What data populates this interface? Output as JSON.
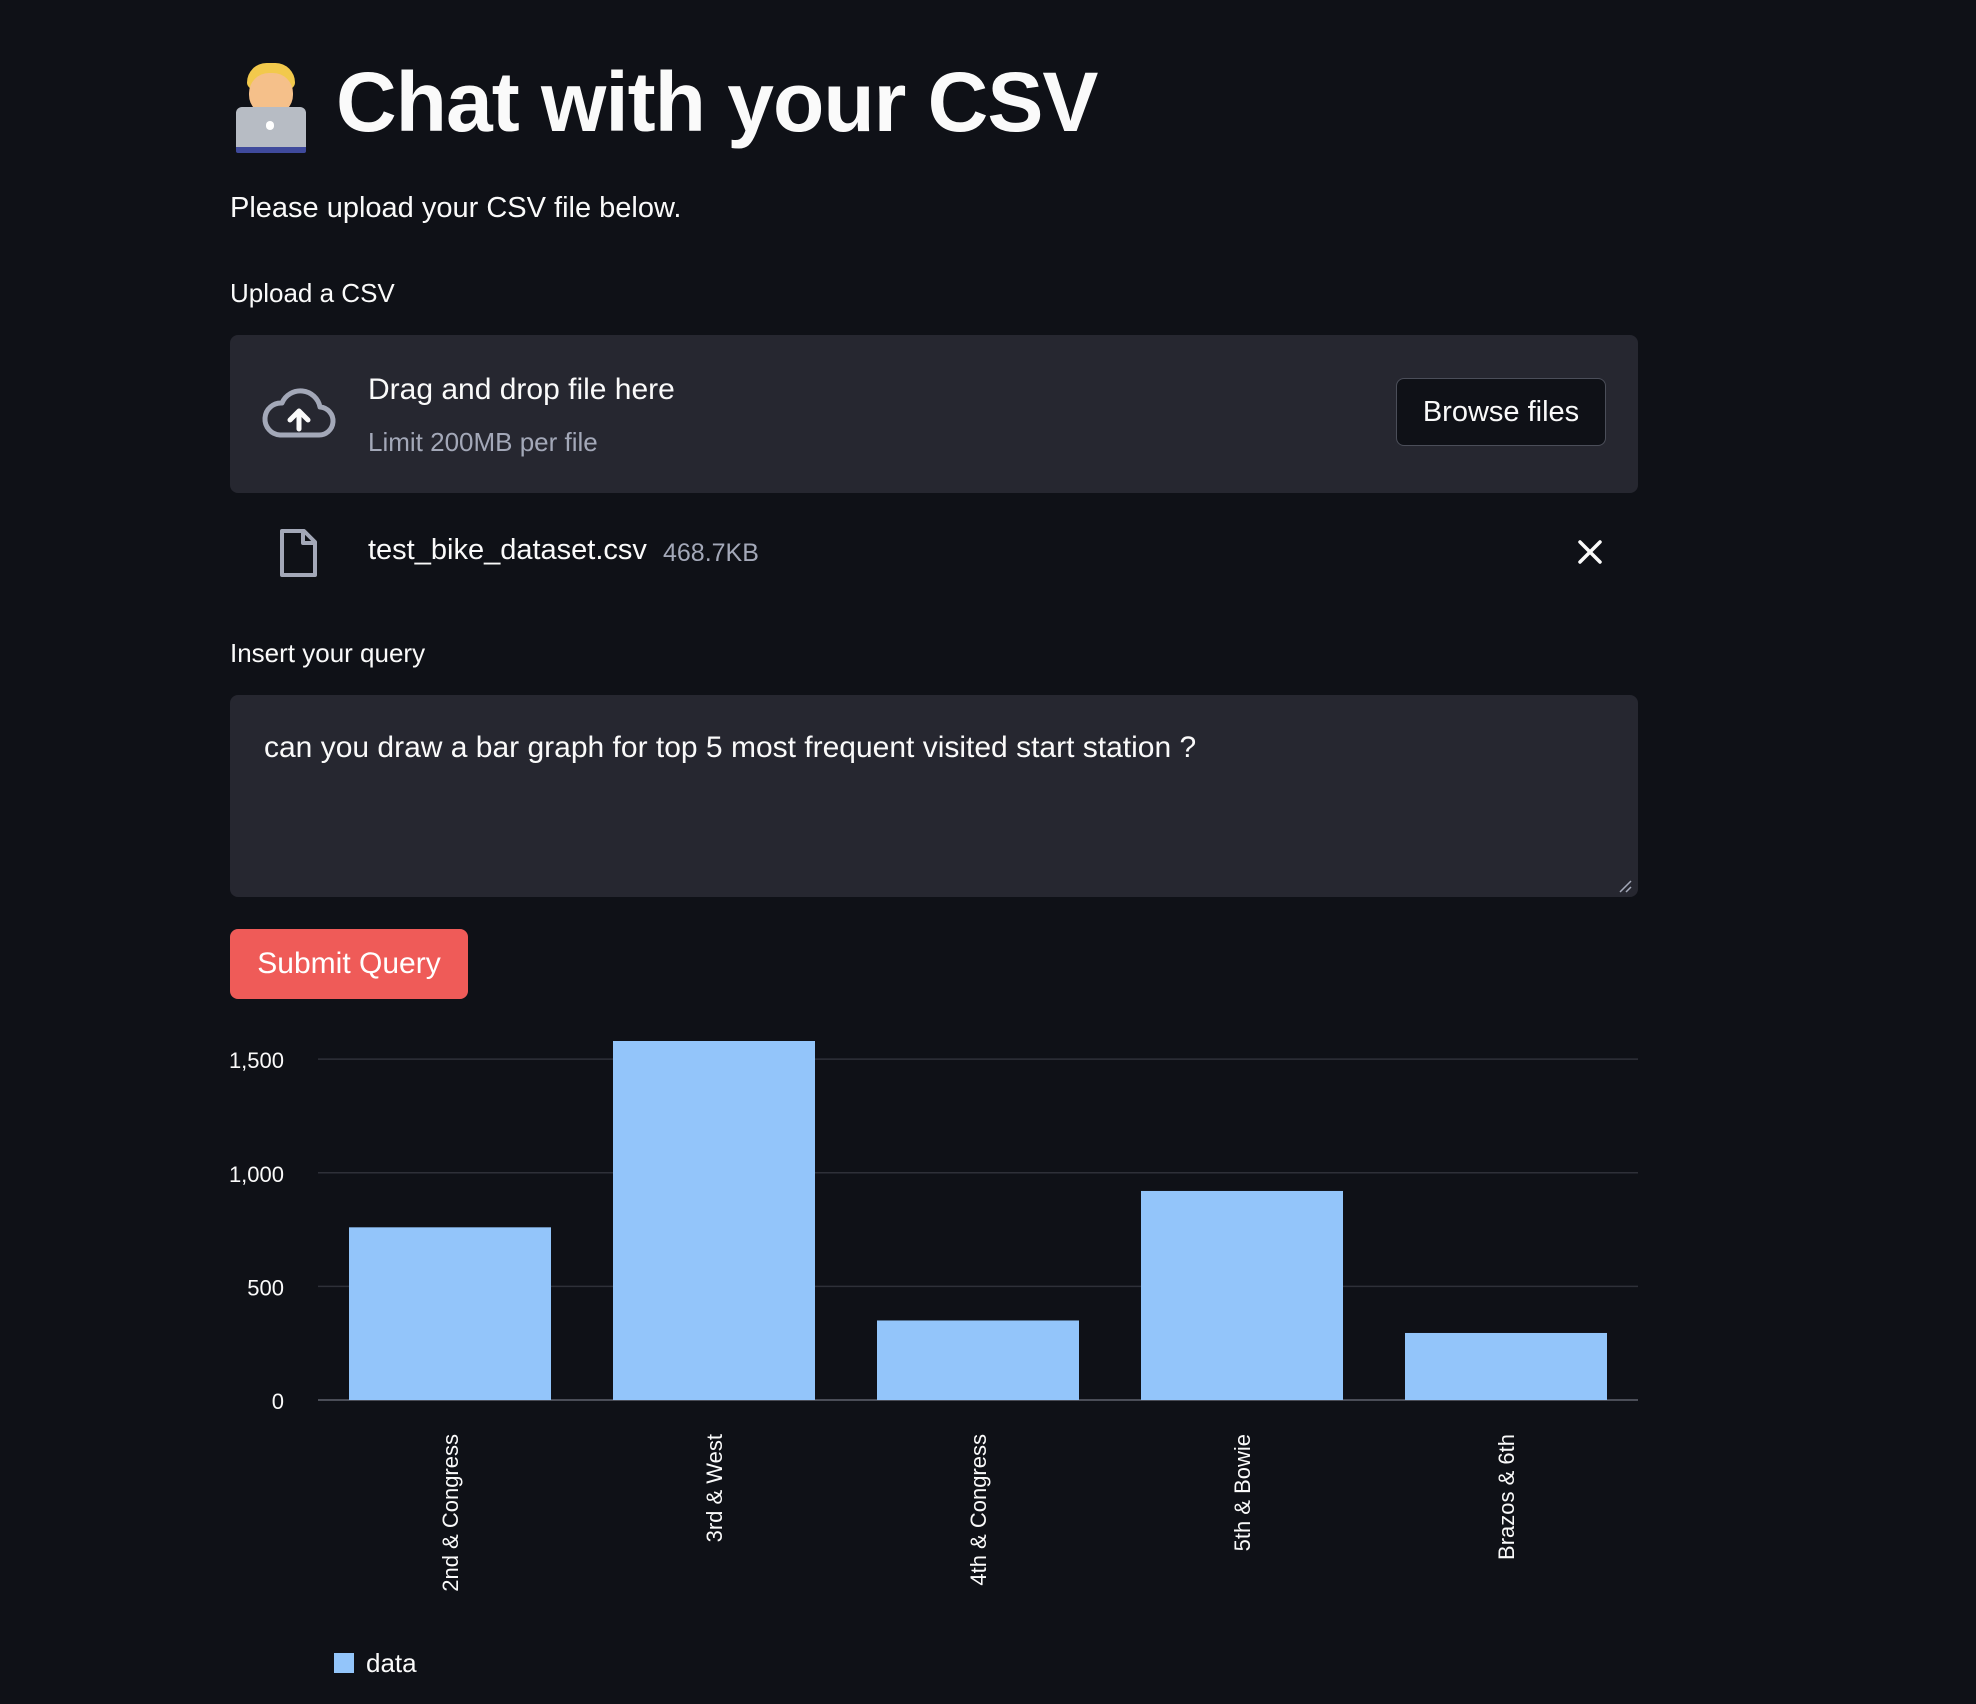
{
  "page": {
    "title": "Chat with your CSV",
    "emoji": "technologist-emoji",
    "subtitle": "Please upload your CSV file below."
  },
  "uploader": {
    "label": "Upload a CSV",
    "drop_title": "Drag and drop file here",
    "drop_limit": "Limit 200MB per file",
    "browse_label": "Browse files",
    "icon": "cloud-upload-icon"
  },
  "file": {
    "name": "test_bike_dataset.csv",
    "size": "468.7KB",
    "icon": "file-icon",
    "remove_icon": "close-icon"
  },
  "query": {
    "label": "Insert your query",
    "value": "can you draw a bar graph for top 5 most frequent visited start station ?"
  },
  "submit": {
    "label": "Submit Query",
    "color": "#ef5b58"
  },
  "colors": {
    "background": "#0f1117",
    "panel": "#262730",
    "bar": "#93c5fa"
  },
  "chart_data": {
    "type": "bar",
    "categories": [
      "2nd & Congress",
      "3rd & West",
      "4th & Congress",
      "5th & Bowie",
      "Brazos & 6th"
    ],
    "values": [
      760,
      1580,
      350,
      920,
      295
    ],
    "yticks": [
      0,
      500,
      1000,
      1500
    ],
    "ytick_labels": [
      "0",
      "500",
      "1,000",
      "1,500"
    ],
    "ylim": [
      0,
      1580
    ],
    "grid": true,
    "legend": {
      "placement": "bottom-left",
      "entries": [
        "data"
      ]
    },
    "series": [
      {
        "name": "data",
        "values": [
          760,
          1580,
          350,
          920,
          295
        ]
      }
    ]
  }
}
